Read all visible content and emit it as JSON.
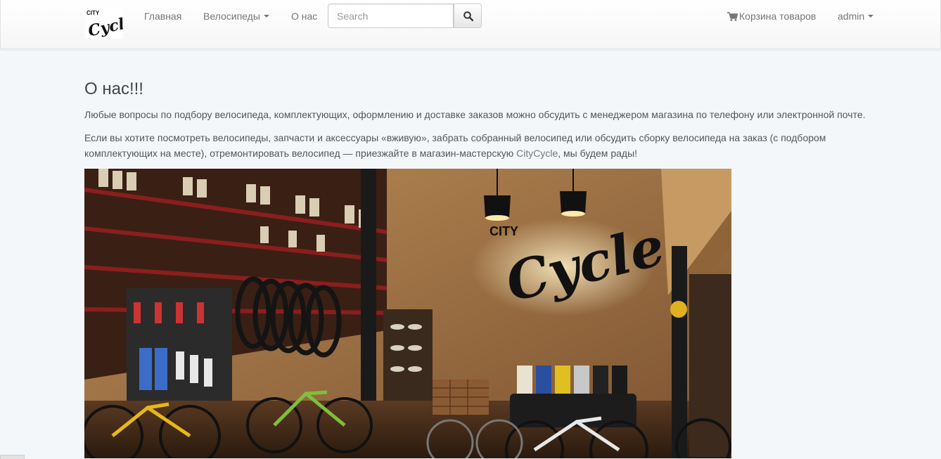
{
  "navbar": {
    "logo": {
      "top_text": "CITY",
      "script_text": "Cycle"
    },
    "links": [
      {
        "label": "Главная"
      },
      {
        "label": "Велосипеды"
      },
      {
        "label": "О нас"
      }
    ],
    "search": {
      "placeholder": "Search",
      "value": ""
    },
    "cart": {
      "label": "Корзина товаров"
    },
    "user": {
      "label": "admin"
    }
  },
  "content": {
    "title": "О нас!!!",
    "paragraph1": "Любые вопросы по подбору велосипеда, комплектующих, оформлению и доставке заказов можно обсудить с менеджером магазина по телефону или электронной почте.",
    "paragraph2_before": "Если вы хотите посмотреть велосипеды, запчасти и аксессуары «вживую», забрать собранный велосипед или обсудить сборку велосипеда на заказ (с подбором комплектующих на месте), отремонтировать велосипед — приезжайте в магазин-мастерскую ",
    "paragraph2_link": "CityCycle",
    "paragraph2_after": ", мы будем рады!",
    "photo": {
      "sign_top": "CITY",
      "sign_script": "Cycle"
    }
  },
  "colors": {
    "background": "#f4f7f9",
    "nav_text": "#777777",
    "heading": "#444444"
  }
}
